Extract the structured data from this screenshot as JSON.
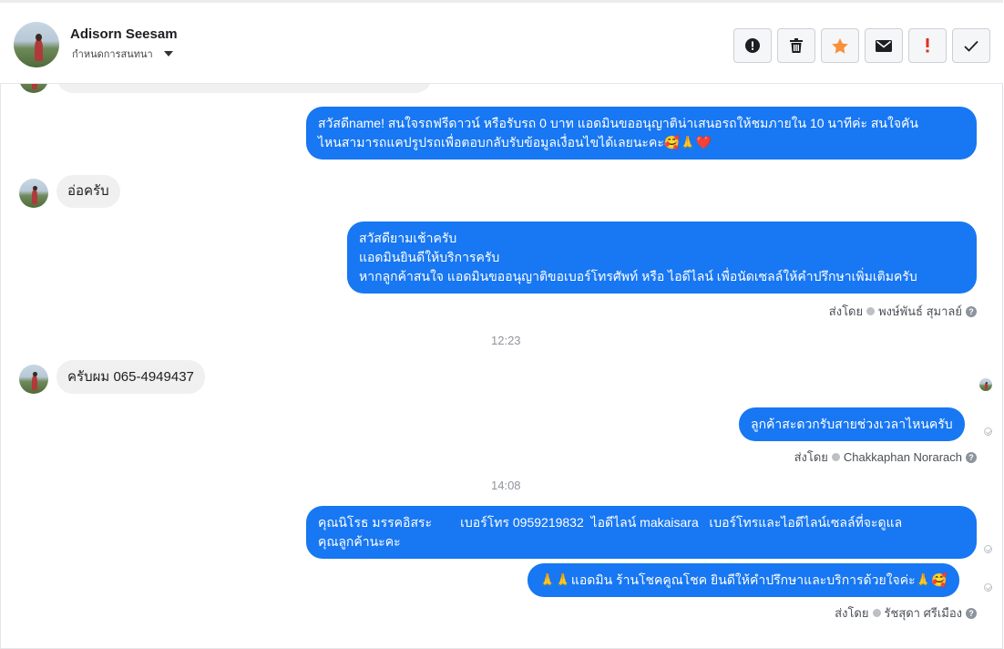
{
  "header": {
    "user_name": "Adisorn Seesam",
    "assign_label": "กำหนดการสนทนา",
    "toolbar": [
      {
        "name": "spam-icon",
        "title": "spam"
      },
      {
        "name": "trash-icon",
        "title": "delete"
      },
      {
        "name": "star-icon",
        "title": "star",
        "color": "#f7923b"
      },
      {
        "name": "mail-icon",
        "title": "unread"
      },
      {
        "name": "important-icon",
        "title": "important",
        "color": "#e0301e"
      },
      {
        "name": "done-icon",
        "title": "done"
      }
    ]
  },
  "messages": {
    "out1": {
      "lines": [
        "สวัสดีname! สนใจรถฟรีดาวน์ หรือรับรถ 0 บาท แอดมินขออนุญาติน่าเสนอรถให้ชมภายใน 10 นาทีค่ะ สนใจคัน",
        "ไหนสามารถแคปรูปรถเพื่อตอบกลับรับข้อมูลเงื่อนไขได้เลยนะคะ🥰🙏❤️"
      ]
    },
    "in1": "อ่อครับ",
    "out2": {
      "lines": [
        "สวัสดียามเช้าครับ",
        "แอดมินยินดีให้บริการครับ",
        "หากลูกค้าสนใจ แอดมินขออนุญาติขอเบอร์โทรศัพท์ หรือ ไอดีไลน์ เพื่อนัดเซลล์ให้คำปรึกษาเพิ่มเติมครับ"
      ]
    },
    "sent_by_1": {
      "prefix": "ส่งโดย",
      "agent": "พงษ์พันธ์ สุมาลย์"
    },
    "time1": "12:23",
    "in2": "ครับผม 065-4949437",
    "out3": "ลูกค้าสะดวกรับสายช่วงเวลาไหนครับ",
    "sent_by_2": {
      "prefix": "ส่งโดย",
      "agent": "Chakkaphan Norarach"
    },
    "time2": "14:08",
    "out4": {
      "lines": [
        "คุณนิโรธ มรรคอิสระ        เบอร์โทร 0959219832  ไอดีไลน์ makaisara   เบอร์โทรและไอดีไลน์เซลล์ที่จะดูแล",
        "คุณลูกค้านะคะ"
      ]
    },
    "out5": "🙏🙏แอดมิน ร้านโชคคูณโชค ยินดีให้คำปรึกษาและบริการด้วยใจค่ะ🙏🥰",
    "sent_by_3": {
      "prefix": "ส่งโดย",
      "agent": "รัชสุดา ศรีเมือง"
    }
  },
  "colors": {
    "brand": "#1877f2",
    "incoming": "#f0f0f0"
  }
}
